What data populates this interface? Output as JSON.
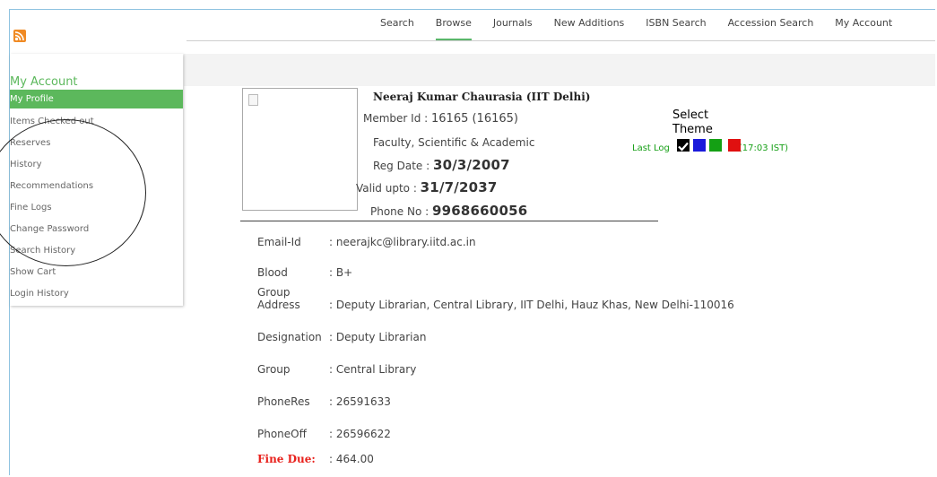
{
  "nav": {
    "items": [
      "Search",
      "Browse",
      "Journals",
      "New Additions",
      "ISBN Search",
      "Accession Search",
      "My Account"
    ],
    "active_index": 1
  },
  "sidebar": {
    "title": "My Account",
    "items": [
      {
        "label": "My Profile",
        "active": true
      },
      {
        "label": "Items Checked out"
      },
      {
        "label": "Reserves"
      },
      {
        "label": "History"
      },
      {
        "label": "Recommendations"
      },
      {
        "label": "Fine Logs"
      },
      {
        "label": "Change Password"
      },
      {
        "label": "Search History"
      },
      {
        "label": "Show Cart"
      },
      {
        "label": "Login History"
      }
    ]
  },
  "profile": {
    "name": "Neeraj Kumar Chaurasia (IIT Delhi)",
    "member_id_label": "Member Id : ",
    "member_id_value": "16165 (16165)",
    "category": "Faculty, Scientific & Academic",
    "reg_date_label": "Reg Date : ",
    "reg_date_value": "30/3/2007",
    "valid_upto_label": "Valid upto : ",
    "valid_upto_value": "31/7/2037",
    "phone_label": "Phone No : ",
    "phone_value": "9968660056"
  },
  "theme": {
    "label_line1": "Select",
    "label_line2": "Theme",
    "last_login_prefix": "Last Log",
    "last_login_suffix": "(17:03 IST)",
    "swatches": [
      "#000000",
      "#1a1adb",
      "#14a014",
      "#e01010"
    ]
  },
  "details": [
    {
      "label": "Email-Id",
      "value": ": neerajkc@library.iitd.ac.in"
    },
    {
      "label": "Blood",
      "value": ": B+"
    },
    {
      "label": "Group",
      "label2": "Address",
      "value": ": Deputy Librarian, Central Library, IIT Delhi, Hauz Khas, New Delhi-110016"
    },
    {
      "label": "Designation",
      "value": ": Deputy Librarian"
    },
    {
      "label": "Group",
      "value": ": Central Library"
    },
    {
      "label": "PhoneRes",
      "value": ": 26591633"
    },
    {
      "label": "PhoneOff",
      "value": ": 26596622"
    },
    {
      "label": "Fine Due:",
      "value": ": 464.00"
    }
  ],
  "colors": {
    "accent_green": "#5cb85c",
    "fine_red": "#e8211c",
    "rss_orange": "#f08a24"
  },
  "icons": {
    "rss": "rss-icon",
    "photo": "broken-image-icon",
    "check": "checkmark-icon"
  }
}
